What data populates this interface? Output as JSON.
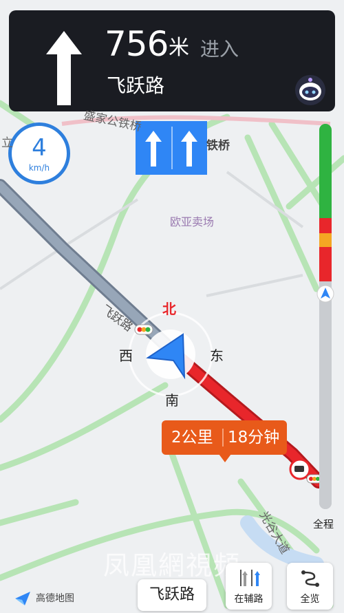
{
  "guidance": {
    "distance": "756",
    "distance_unit": "米",
    "action": "进入",
    "next_road": "飞跃路"
  },
  "speed": {
    "value": "4",
    "unit": "km/h"
  },
  "map": {
    "poi_label": "欧亚卖场",
    "road_label_main": "飞跃路",
    "road_label_top_left": "盛家公铁桥",
    "road_label_top_right": "铁桥",
    "road_label_bottom": "光谷大道",
    "road_label_left_edge": "立"
  },
  "compass": {
    "north": "北",
    "south": "南",
    "east": "东",
    "west": "西"
  },
  "route_info": {
    "distance": "2公里",
    "time": "18分钟"
  },
  "traffic_bar": {
    "full_route_label": "全程",
    "progress_fraction": 0.43
  },
  "bottom_bar": {
    "logo_text": "高德地图",
    "current_road": "飞跃路",
    "aux_road_label": "在辅路",
    "overview_label": "全览"
  },
  "watermark": "凤凰網視頻",
  "colors": {
    "route_red": "#e8262b",
    "route_grey": "#8e99a8",
    "traffic_green": "#2fb341",
    "traffic_yellow": "#f5a623",
    "accent_blue": "#2f86f5",
    "panel_bg": "#1a1c22",
    "bubble_orange": "#e85a1a"
  }
}
